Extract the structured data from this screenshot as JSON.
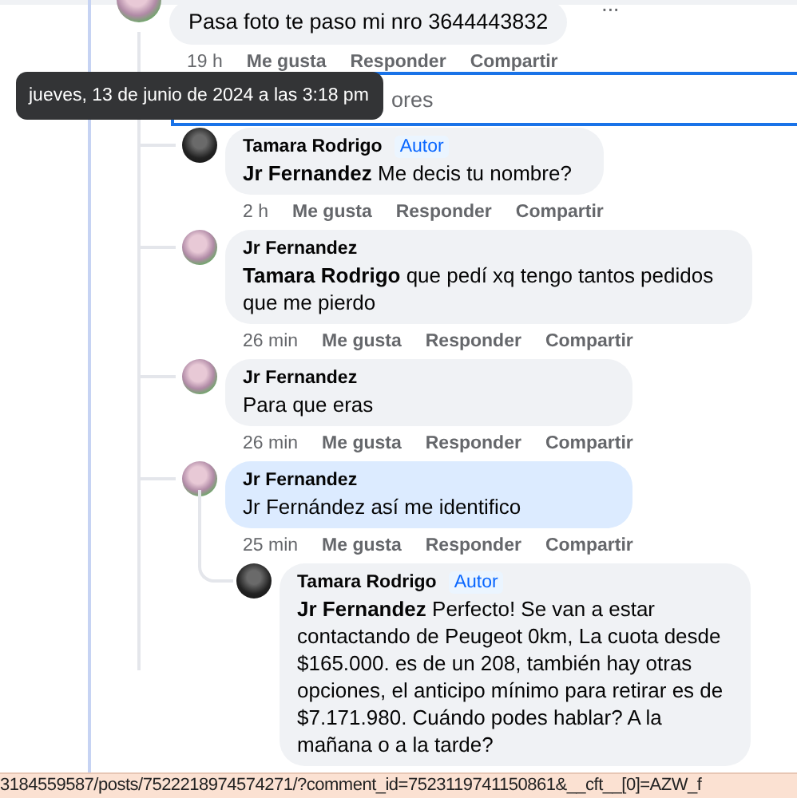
{
  "top_comment": {
    "text": "Pasa foto te paso mi nro 3644443832",
    "more": "···",
    "time": "19 h",
    "actions": [
      "Me gusta",
      "Responder",
      "Compartir"
    ]
  },
  "previous_replies_link": {
    "label": "ores",
    "focused": true
  },
  "tooltip": "jueves, 13 de junio de 2024 a las 3:18 pm",
  "replies": [
    {
      "author": "Tamara Rodrigo",
      "badge": "Autor",
      "text": "**Jr Fernandez** Me decis tu nombre?",
      "time": "2 h",
      "actions": [
        "Me gusta",
        "Responder",
        "Compartir"
      ],
      "highlighted": false
    },
    {
      "author": "Jr Fernandez",
      "text": "**Tamara Rodrigo** que pedí xq tengo tantos pedidos que me pierdo",
      "time": "26 min",
      "actions": [
        "Me gusta",
        "Responder",
        "Compartir"
      ],
      "highlighted": false
    },
    {
      "author": "Jr Fernandez",
      "text": "Para que eras",
      "time": "26 min",
      "actions": [
        "Me gusta",
        "Responder",
        "Compartir"
      ],
      "highlighted": false
    },
    {
      "author": "Jr Fernandez",
      "text": "Jr Fernández así me identifico",
      "time": "25 min",
      "actions": [
        "Me gusta",
        "Responder",
        "Compartir"
      ],
      "highlighted": true,
      "children": [
        {
          "author": "Tamara Rodrigo",
          "badge": "Autor",
          "text": "**Jr Fernandez** Perfecto! Se van a estar contactando de Peugeot 0km, La cuota desde $165.000. es de un 208, también hay otras opciones, el anticipo mínimo para retirar es de $7.171.980. Cuándo podes hablar? A la mañana o a la tarde?",
          "highlighted": false
        }
      ]
    }
  ],
  "status_bar": "3184559587/posts/7522218974574271/?comment_id=7523119741150861&__cft__[0]=AZW_f"
}
